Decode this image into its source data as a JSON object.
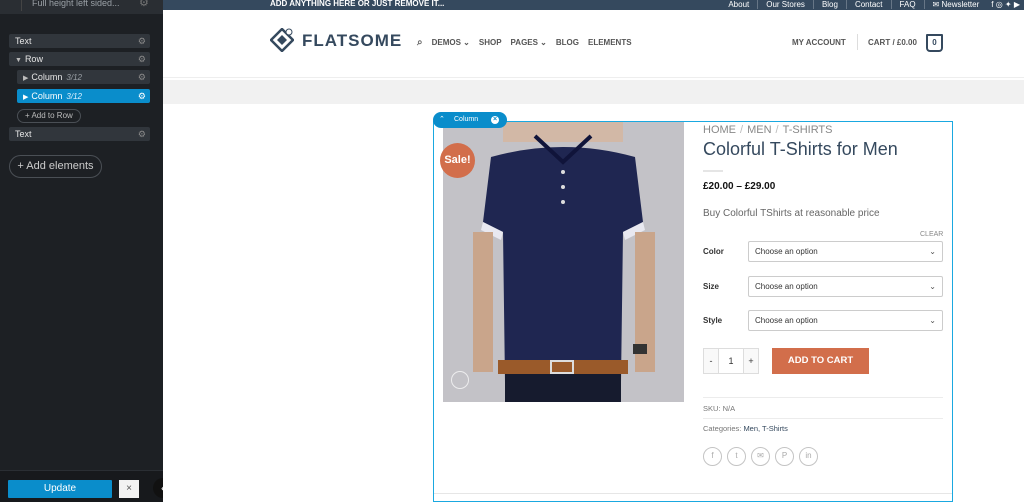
{
  "sidebar": {
    "header_title": "Full height left sided...",
    "tree": [
      {
        "label": "Text",
        "span": ""
      },
      {
        "label": "Row",
        "span": ""
      },
      {
        "label": "Column",
        "span": "3/12"
      },
      {
        "label": "Column",
        "span": "3/12"
      },
      {
        "label": "Text",
        "span": ""
      }
    ],
    "add_to_row": "+ Add to Row",
    "add_elements": "+ Add elements",
    "update": "Update",
    "close": "×",
    "collapse": "‹"
  },
  "topbar": {
    "announcement": "ADD ANYTHING HERE OR JUST REMOVE IT...",
    "links": [
      "About",
      "Our Stores",
      "Blog",
      "Contact",
      "FAQ",
      "✉ Newsletter"
    ],
    "social": "f ◎ ✦ ▶"
  },
  "header": {
    "logo": "FLATSOME",
    "nav": [
      "DEMOS ⌄",
      "SHOP",
      "PAGES ⌄",
      "BLOG",
      "ELEMENTS"
    ],
    "account": "MY ACCOUNT",
    "cart": "CART / £0.00",
    "cart_count": "0"
  },
  "column_tag": {
    "label": "Column",
    "up": "⌃",
    "close": "×"
  },
  "product": {
    "sale_badge": "Sale!",
    "breadcrumb": [
      "HOME",
      "MEN",
      "T-SHIRTS"
    ],
    "breadcrumb_sep": "/",
    "title": "Colorful T-Shirts for Men",
    "price": "£20.00 – £29.00",
    "short_description": "Buy Colorful TShirts at reasonable price",
    "clear": "CLEAR",
    "variations": [
      {
        "label": "Color",
        "value": "Choose an option"
      },
      {
        "label": "Size",
        "value": "Choose an option"
      },
      {
        "label": "Style",
        "value": "Choose an option"
      }
    ],
    "qty_minus": "-",
    "qty_value": "1",
    "qty_plus": "+",
    "add_to_cart": "ADD TO CART",
    "sku_label": "SKU: ",
    "sku_value": "N/A",
    "categories_label": "Categories: ",
    "categories_value": "Men, T-Shirts",
    "share_icons": [
      "f",
      "t",
      "✉",
      "P",
      "in"
    ]
  },
  "colors": {
    "accent": "#0a8dcb",
    "primary": "#35495e",
    "button": "#d26e4b",
    "sidebar_bg": "#1d2024"
  }
}
